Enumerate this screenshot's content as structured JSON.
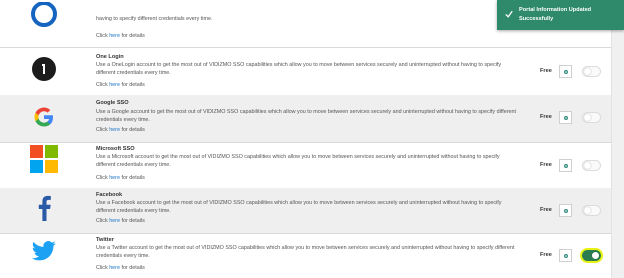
{
  "providers": [
    {
      "name": "",
      "description": "having to specify different credentials every time.",
      "details_prefix": "Click ",
      "details_link": "here",
      "details_suffix": " for details",
      "price": "",
      "enabled": false
    },
    {
      "name": "One Login",
      "description": "Use a OneLogin account to get the most out of VIDIZMO SSO capabilities which allow you to move between services securely and uninterrupted without having to specify different credentials every time.",
      "details_prefix": "Click ",
      "details_link": "here",
      "details_suffix": " for details",
      "price": "Free",
      "enabled": false
    },
    {
      "name": "Google SSO",
      "description": "Use a Google account to get the most out of VIDIZMO SSO capabilities which allow you to move between services securely and uninterrupted without having to specify different credentials every time.",
      "details_prefix": "Click ",
      "details_link": "here",
      "details_suffix": " for details",
      "price": "Free",
      "enabled": false
    },
    {
      "name": "Microsoft SSO",
      "description": "Use a Microsoft account to get the most out of VIDIZMO SSO capabilities which allow you to move between services securely and uninterrupted without having to specify different credentials every time.",
      "details_prefix": "Click ",
      "details_link": "here",
      "details_suffix": " for details",
      "price": "Free",
      "enabled": false
    },
    {
      "name": "Facebook",
      "description": "Use a Facebook account to get the most out of VIDIZMO SSO capabilities which allow you to move between services securely and uninterrupted without having to specify different credentials every time.",
      "details_prefix": "Click ",
      "details_link": "here",
      "details_suffix": " for details",
      "price": "Free",
      "enabled": false
    },
    {
      "name": "Twitter",
      "description": "Use a Twitter account to get the most out of VIDIZMO SSO capabilities which allow you to move between services securely and uninterrupted without having to specify different credentials every time.",
      "details_prefix": "Click ",
      "details_link": "here",
      "details_suffix": " for details",
      "price": "Free",
      "enabled": true
    }
  ],
  "toast": {
    "message": "Portal Information Updated Successfully"
  },
  "colors": {
    "topbar": "#2e8b84",
    "toast": "#2f8a6b",
    "link": "#1a73c9",
    "toggle_on": "#2b7d51",
    "focus_ring": "#e8f214"
  }
}
